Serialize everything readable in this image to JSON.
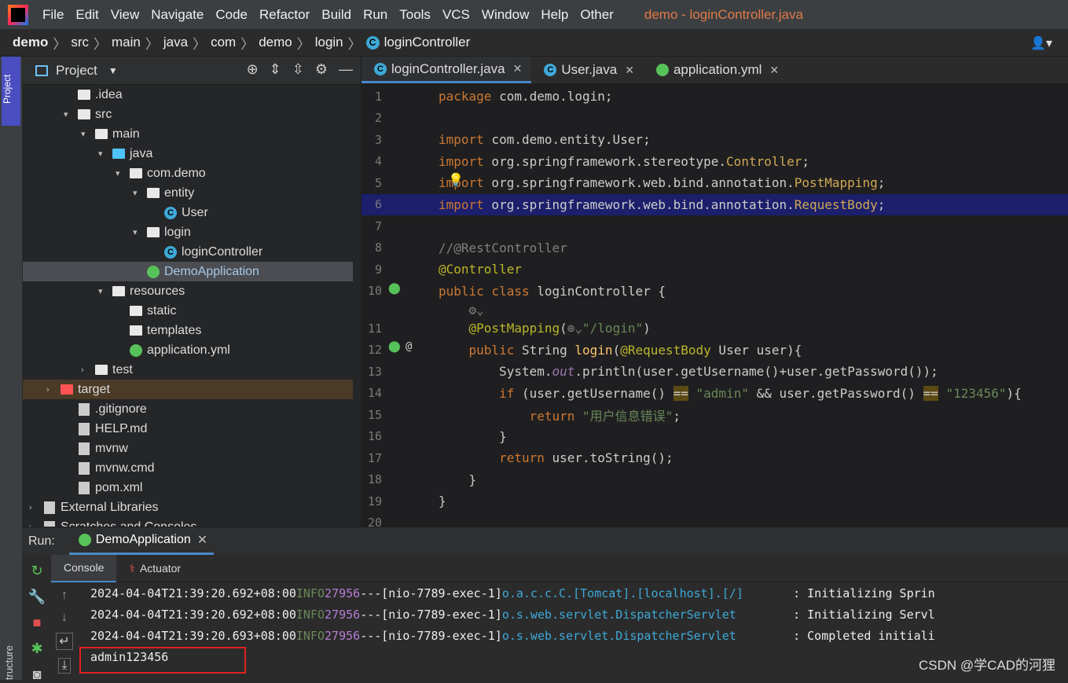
{
  "menubar": {
    "items": [
      "File",
      "Edit",
      "View",
      "Navigate",
      "Code",
      "Refactor",
      "Build",
      "Run",
      "Tools",
      "VCS",
      "Window",
      "Help",
      "Other"
    ],
    "title": "demo - loginController.java"
  },
  "breadcrumb": [
    "demo",
    "src",
    "main",
    "java",
    "com",
    "demo",
    "login",
    "loginController"
  ],
  "sidebar": {
    "project_tab": "Project",
    "structure_tab": "tructure"
  },
  "project_panel": {
    "title": "Project",
    "tree": [
      {
        "label": ".idea",
        "depth": 2,
        "icon": "folder"
      },
      {
        "label": "src",
        "depth": 2,
        "icon": "folder",
        "arrow": "v"
      },
      {
        "label": "main",
        "depth": 3,
        "icon": "folder",
        "arrow": "v"
      },
      {
        "label": "java",
        "depth": 4,
        "icon": "folder-blue",
        "arrow": "v"
      },
      {
        "label": "com.demo",
        "depth": 5,
        "icon": "package",
        "arrow": "v"
      },
      {
        "label": "entity",
        "depth": 6,
        "icon": "package",
        "arrow": "v"
      },
      {
        "label": "User",
        "depth": 7,
        "icon": "class"
      },
      {
        "label": "login",
        "depth": 6,
        "icon": "package",
        "arrow": "v"
      },
      {
        "label": "loginController",
        "depth": 7,
        "icon": "class"
      },
      {
        "label": "DemoApplication",
        "depth": 6,
        "icon": "spring-class",
        "selected": true
      },
      {
        "label": "resources",
        "depth": 4,
        "icon": "folder",
        "arrow": "v"
      },
      {
        "label": "static",
        "depth": 5,
        "icon": "folder"
      },
      {
        "label": "templates",
        "depth": 5,
        "icon": "folder"
      },
      {
        "label": "application.yml",
        "depth": 5,
        "icon": "spring-config"
      },
      {
        "label": "test",
        "depth": 3,
        "icon": "folder",
        "arrow": ">"
      },
      {
        "label": "target",
        "depth": 1,
        "icon": "folder-red",
        "arrow": ">",
        "target": true
      },
      {
        "label": ".gitignore",
        "depth": 2,
        "icon": "file"
      },
      {
        "label": "HELP.md",
        "depth": 2,
        "icon": "file"
      },
      {
        "label": "mvnw",
        "depth": 2,
        "icon": "file"
      },
      {
        "label": "mvnw.cmd",
        "depth": 2,
        "icon": "file"
      },
      {
        "label": "pom.xml",
        "depth": 2,
        "icon": "maven"
      },
      {
        "label": "External Libraries",
        "depth": 0,
        "icon": "libs",
        "arrow": ">"
      },
      {
        "label": "Scratches and Consoles",
        "depth": 0,
        "icon": "scratch",
        "arrow": ">"
      }
    ]
  },
  "editor_tabs": [
    {
      "label": "loginController.java",
      "icon": "class",
      "active": true
    },
    {
      "label": "User.java",
      "icon": "class"
    },
    {
      "label": "application.yml",
      "icon": "spring-config"
    }
  ],
  "code_lines": [
    {
      "n": "1",
      "html": "<span class='kw'>package</span> com.demo.login;"
    },
    {
      "n": "2",
      "html": ""
    },
    {
      "n": "3",
      "html": "<span class='kw'>import</span> com.demo.entity.User;"
    },
    {
      "n": "4",
      "html": "<span class='kw'>import</span> org.springframework.stereotype.<span class='typ'>Controller</span>;"
    },
    {
      "n": "5",
      "html": "<span class='kw'>import</span> org.springframework.web.bind.annotation.<span class='typ'>PostMapping</span>;"
    },
    {
      "n": "6",
      "html": "<span class='kw'>import</span> org.springframework.web.bind.annotation.<span class='typ'>RequestBody</span>;",
      "hl": true
    },
    {
      "n": "7",
      "html": ""
    },
    {
      "n": "8",
      "html": "<span class='cm'>//@RestController</span>"
    },
    {
      "n": "9",
      "html": "<span class='ann'>@Controller</span>"
    },
    {
      "n": "10",
      "html": "<span class='kw'>public class</span> loginController {"
    },
    {
      "n": "",
      "html": "    <span class='cm'>⚙⌄</span>"
    },
    {
      "n": "11",
      "html": "    <span class='ann'>@PostMapping</span>(<span class='cm'>⊕⌄</span><span class='str'>\"/login\"</span>)"
    },
    {
      "n": "12",
      "html": "    <span class='kw'>public</span> String <span class='fn'>login</span>(<span class='ann'>@RequestBody</span> User user){"
    },
    {
      "n": "13",
      "html": "        System.<span class='field'>out</span>.println(user.getUsername()+user.getPassword());"
    },
    {
      "n": "14",
      "html": "        <span class='kw'>if</span> (user.getUsername() <span class='eqhl'>==</span> <span class='str'>\"admin\"</span> &amp;&amp; user.getPassword() <span class='eqhl'>==</span> <span class='str'>\"123456\"</span>){"
    },
    {
      "n": "15",
      "html": "            <span class='kw'>return</span> <span class='str'>\"用户信息错误\"</span>;"
    },
    {
      "n": "16",
      "html": "        }"
    },
    {
      "n": "17",
      "html": "        <span class='kw'>return</span> user.toString();"
    },
    {
      "n": "18",
      "html": "    }"
    },
    {
      "n": "19",
      "html": "}"
    },
    {
      "n": "20",
      "html": ""
    }
  ],
  "run_panel": {
    "label": "Run:",
    "tab": "DemoApplication",
    "subtabs": [
      "Console",
      "Actuator"
    ],
    "log_lines": [
      {
        "ts": "2024-04-04T21:39:20.692+08:00",
        "level": "INFO",
        "pid": "27956",
        "sep": "---",
        "thread": "[nio-7789-exec-1]",
        "logger": "o.a.c.c.C.[Tomcat].[localhost].[/]       ",
        "msg": ": Initializing Sprin"
      },
      {
        "ts": "2024-04-04T21:39:20.692+08:00",
        "level": "INFO",
        "pid": "27956",
        "sep": "---",
        "thread": "[nio-7789-exec-1]",
        "logger": "o.s.web.servlet.DispatcherServlet        ",
        "msg": ": Initializing Servl"
      },
      {
        "ts": "2024-04-04T21:39:20.693+08:00",
        "level": "INFO",
        "pid": "27956",
        "sep": "---",
        "thread": "[nio-7789-exec-1]",
        "logger": "o.s.web.servlet.DispatcherServlet        ",
        "msg": ": Completed initiali"
      }
    ],
    "output": "admin123456"
  },
  "watermark": "CSDN @学CAD的河狸"
}
